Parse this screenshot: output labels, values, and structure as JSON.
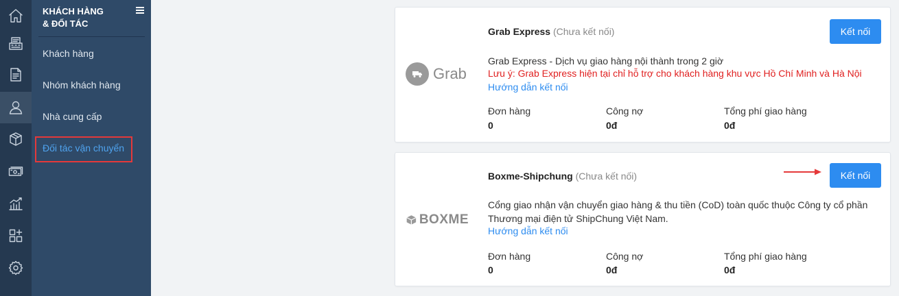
{
  "sidebar_icons": [
    "home-icon",
    "cash-register-icon",
    "invoice-icon",
    "customer-icon",
    "box-icon",
    "money-icon",
    "report-chart-icon",
    "apps-icon",
    "settings-icon"
  ],
  "submenu": {
    "title_line1": "KHÁCH HÀNG",
    "title_line2": "& ĐỐI TÁC",
    "items": [
      {
        "label": "Khách hàng"
      },
      {
        "label": "Nhóm khách hàng"
      },
      {
        "label": "Nhà cung cấp"
      },
      {
        "label": "Đối tác vận chuyển",
        "selected": true
      }
    ]
  },
  "partners": [
    {
      "logo_text": "Grab",
      "name": "Grab Express",
      "status": "(Chưa kết nối)",
      "connect_label": "Kết nối",
      "description": "Grab Express - Dịch vụ giao hàng nội thành trong 2 giờ",
      "warning": "Lưu ý: Grab Express hiện tại chỉ hỗ trợ cho khách hàng khu vực Hồ Chí Minh và Hà Nội",
      "guide_label": "Hướng dẫn kết nối",
      "stats": [
        {
          "label": "Đơn hàng",
          "value": "0"
        },
        {
          "label": "Công nợ",
          "value": "0đ"
        },
        {
          "label": "Tổng phí giao hàng",
          "value": "0đ"
        }
      ]
    },
    {
      "logo_text": "BOXME",
      "name": "Boxme-Shipchung",
      "status": "(Chưa kết nối)",
      "connect_label": "Kết nối",
      "description": "Cổng giao nhận vận chuyển giao hàng & thu tiền (CoD) toàn quốc thuộc Công ty cổ phần Thương mại điện tử ShipChung Việt Nam.",
      "guide_label": "Hướng dẫn kết nối",
      "stats": [
        {
          "label": "Đơn hàng",
          "value": "0"
        },
        {
          "label": "Công nợ",
          "value": "0đ"
        },
        {
          "label": "Tổng phí giao hàng",
          "value": "0đ"
        }
      ]
    }
  ],
  "colors": {
    "primary": "#2d8cf0",
    "warning": "#e01f1f",
    "sidebar": "#253950",
    "submenu": "#2f4a68",
    "highlight": "#e5393a"
  }
}
